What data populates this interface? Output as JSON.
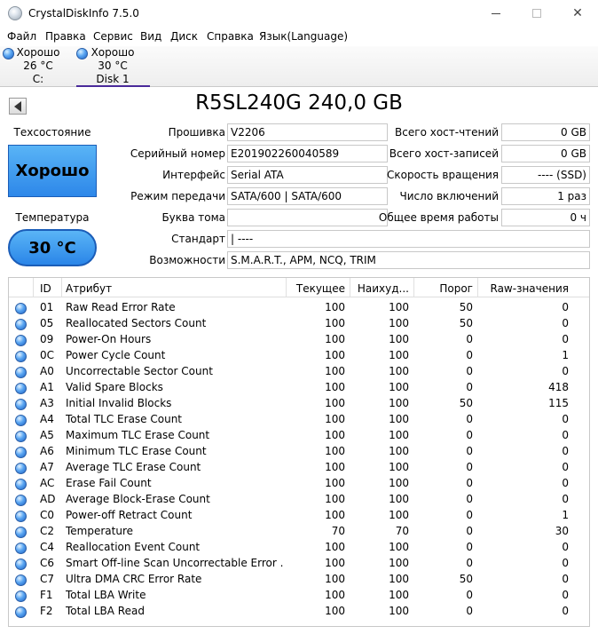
{
  "window": {
    "title": "CrystalDiskInfo 7.5.0"
  },
  "menu": [
    "Файл",
    "Правка",
    "Сервис",
    "Вид",
    "Диск",
    "Справка",
    "Язык(Language)"
  ],
  "disks": [
    {
      "status": "Хорошо",
      "temp": "26 °C",
      "label": "C:"
    },
    {
      "status": "Хорошо",
      "temp": "30 °C",
      "label": "Disk 1"
    }
  ],
  "drive": {
    "title": "R5SL240G 240,0 GB",
    "health_label": "Техсостояние",
    "health_value": "Хорошо",
    "temp_label": "Температура",
    "temp_value": "30 °C",
    "firmware_label": "Прошивка",
    "firmware": "V2206",
    "serial_label": "Серийный номер",
    "serial": "E201902260040589",
    "interface_label": "Интерфейс",
    "interface": "Serial ATA",
    "transfer_label": "Режим передачи",
    "transfer": "SATA/600 | SATA/600",
    "volume_label": "Буква тома",
    "volume": "",
    "standard_label": "Стандарт",
    "standard": " | ----",
    "features_label": "Возможности",
    "features": "S.M.A.R.T., APM, NCQ, TRIM",
    "host_reads_label": "Всего хост-чтений",
    "host_reads": "0 GB",
    "host_writes_label": "Всего хост-записей",
    "host_writes": "0 GB",
    "rotation_label": "Скорость вращения",
    "rotation": "---- (SSD)",
    "power_count_label": "Число включений",
    "power_count": "1 раз",
    "power_hours_label": "Общее время работы",
    "power_hours": "0 ч"
  },
  "smart": {
    "headers": [
      "ID",
      "Атрибут",
      "Текущее",
      "Наихуд...",
      "Порог",
      "Raw-значения"
    ],
    "rows": [
      [
        "01",
        "Raw Read Error Rate",
        "100",
        "100",
        "50",
        "0"
      ],
      [
        "05",
        "Reallocated Sectors Count",
        "100",
        "100",
        "50",
        "0"
      ],
      [
        "09",
        "Power-On Hours",
        "100",
        "100",
        "0",
        "0"
      ],
      [
        "0C",
        "Power Cycle Count",
        "100",
        "100",
        "0",
        "1"
      ],
      [
        "A0",
        "Uncorrectable Sector Count",
        "100",
        "100",
        "0",
        "0"
      ],
      [
        "A1",
        "Valid Spare Blocks",
        "100",
        "100",
        "0",
        "418"
      ],
      [
        "A3",
        "Initial Invalid Blocks",
        "100",
        "100",
        "50",
        "115"
      ],
      [
        "A4",
        "Total TLC Erase Count",
        "100",
        "100",
        "0",
        "0"
      ],
      [
        "A5",
        "Maximum TLC Erase Count",
        "100",
        "100",
        "0",
        "0"
      ],
      [
        "A6",
        "Minimum TLC Erase Count",
        "100",
        "100",
        "0",
        "0"
      ],
      [
        "A7",
        "Average TLC Erase Count",
        "100",
        "100",
        "0",
        "0"
      ],
      [
        "AC",
        "Erase Fail Count",
        "100",
        "100",
        "0",
        "0"
      ],
      [
        "AD",
        "Average Block-Erase Count",
        "100",
        "100",
        "0",
        "0"
      ],
      [
        "C0",
        "Power-off Retract Count",
        "100",
        "100",
        "0",
        "1"
      ],
      [
        "C2",
        "Temperature",
        "70",
        "70",
        "0",
        "30"
      ],
      [
        "C4",
        "Reallocation Event Count",
        "100",
        "100",
        "0",
        "0"
      ],
      [
        "C6",
        "Smart Off-line Scan Uncorrectable Error ...",
        "100",
        "100",
        "0",
        "0"
      ],
      [
        "C7",
        "Ultra DMA CRC Error Rate",
        "100",
        "100",
        "50",
        "0"
      ],
      [
        "F1",
        "Total LBA Write",
        "100",
        "100",
        "0",
        "0"
      ],
      [
        "F2",
        "Total LBA Read",
        "100",
        "100",
        "0",
        "0"
      ]
    ]
  },
  "colors": {
    "good": "#2d87e9",
    "accent": "#4a2a9a"
  }
}
